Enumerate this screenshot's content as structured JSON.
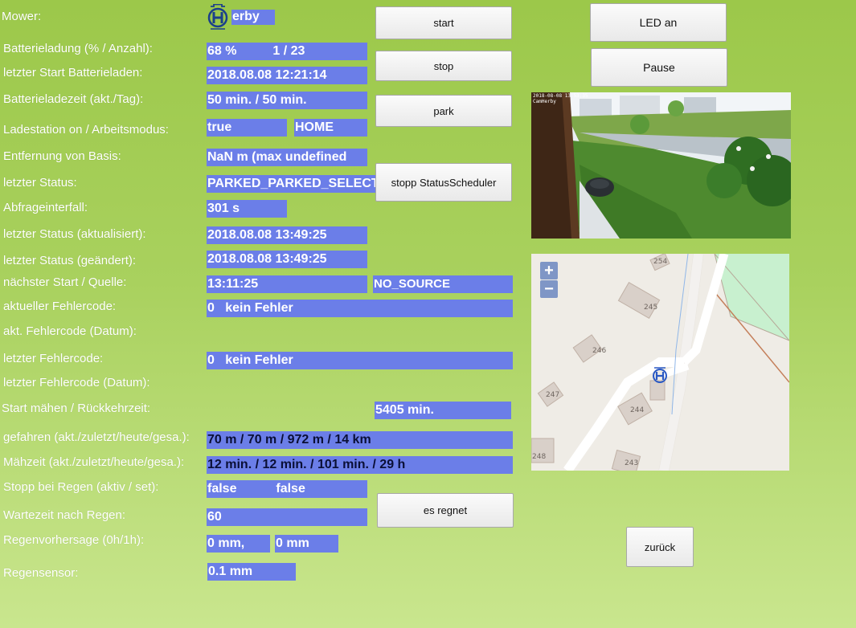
{
  "labels": {
    "mower": "Mower:",
    "battery": "Batterieladung (% / Anzahl):",
    "last_charge_start": "letzter Start Batterieladen:",
    "charge_time": "Batterieladezeit (akt./Tag):",
    "station_mode": "Ladestation on / Arbeitsmodus:",
    "distance": "Entfernung von Basis:",
    "last_status": "letzter Status:",
    "poll_interval": "Abfrageinterfall:",
    "status_updated": "letzter Status (aktualisiert):",
    "status_changed": "letzter Status (geändert):",
    "next_start": "nächster Start / Quelle:",
    "current_error": "aktueller Fehlercode:",
    "current_error_date": "akt. Fehlercode (Datum):",
    "last_error": "letzter Fehlercode:",
    "last_error_date": "letzter Fehlercode (Datum):",
    "mow_start_return": "Start mähen / Rückkehrzeit:",
    "driven": "gefahren (akt./zuletzt/heute/gesa.):",
    "mow_time": "Mähzeit (akt./zuletzt/heute/gesa.):",
    "rain_stop": "Stopp bei Regen (aktiv / set):",
    "rain_wait": "Wartezeit nach Regen:",
    "rain_forecast": "Regenvorhersage (0h/1h):",
    "rain_sensor": "Regensensor:"
  },
  "values": {
    "mower_name": "erby",
    "battery_pct": "68 %",
    "battery_count": "1 / 23",
    "last_charge_start": "2018.08.08 12:21:14",
    "charge_time": "50 min. / 50 min.",
    "station_on": "true",
    "work_mode": "HOME",
    "distance": "NaN m (max undefined",
    "last_status": "PARKED_PARKED_SELECTED",
    "poll_interval": "301 s",
    "status_updated": "2018.08.08 13:49:25",
    "status_changed": "2018.08.08 13:49:25",
    "next_start": "13:11:25",
    "next_start_source": "NO_SOURCE",
    "current_error_code": "0",
    "current_error_text": "kein Fehler",
    "last_error_code": "0",
    "last_error_text": "kein Fehler",
    "return_time": "5405 min.",
    "driven": "70 m / 70 m / 972 m / 14 km",
    "mow_time": "12 min. / 12 min. / 101 min. / 29 h",
    "rain_stop_active": "false",
    "rain_stop_set": "false",
    "rain_wait": "60",
    "rain_forecast_0h": "0 mm,",
    "rain_forecast_1h": "0 mm",
    "rain_sensor": "0.1 mm"
  },
  "buttons": {
    "start": "start",
    "stop": "stop",
    "park": "park",
    "stop_scheduler": "stopp StatusScheduler",
    "rain": "es regnet",
    "led": "LED an",
    "pause": "Pause",
    "back": "zurück"
  },
  "camera": {
    "timestamp": "2018-08-08 13:53:35",
    "name": "CamHerby"
  },
  "map": {
    "zoom_in": "+",
    "zoom_out": "−",
    "houses": [
      "254",
      "245",
      "246",
      "247",
      "244",
      "248",
      "243"
    ]
  },
  "icons": {
    "logo": "husqvarna-logo-icon",
    "map_marker": "husqvarna-marker-icon"
  },
  "colors": {
    "value_bg": "#6b7ee8",
    "brand_blue": "#1b3f8b"
  }
}
